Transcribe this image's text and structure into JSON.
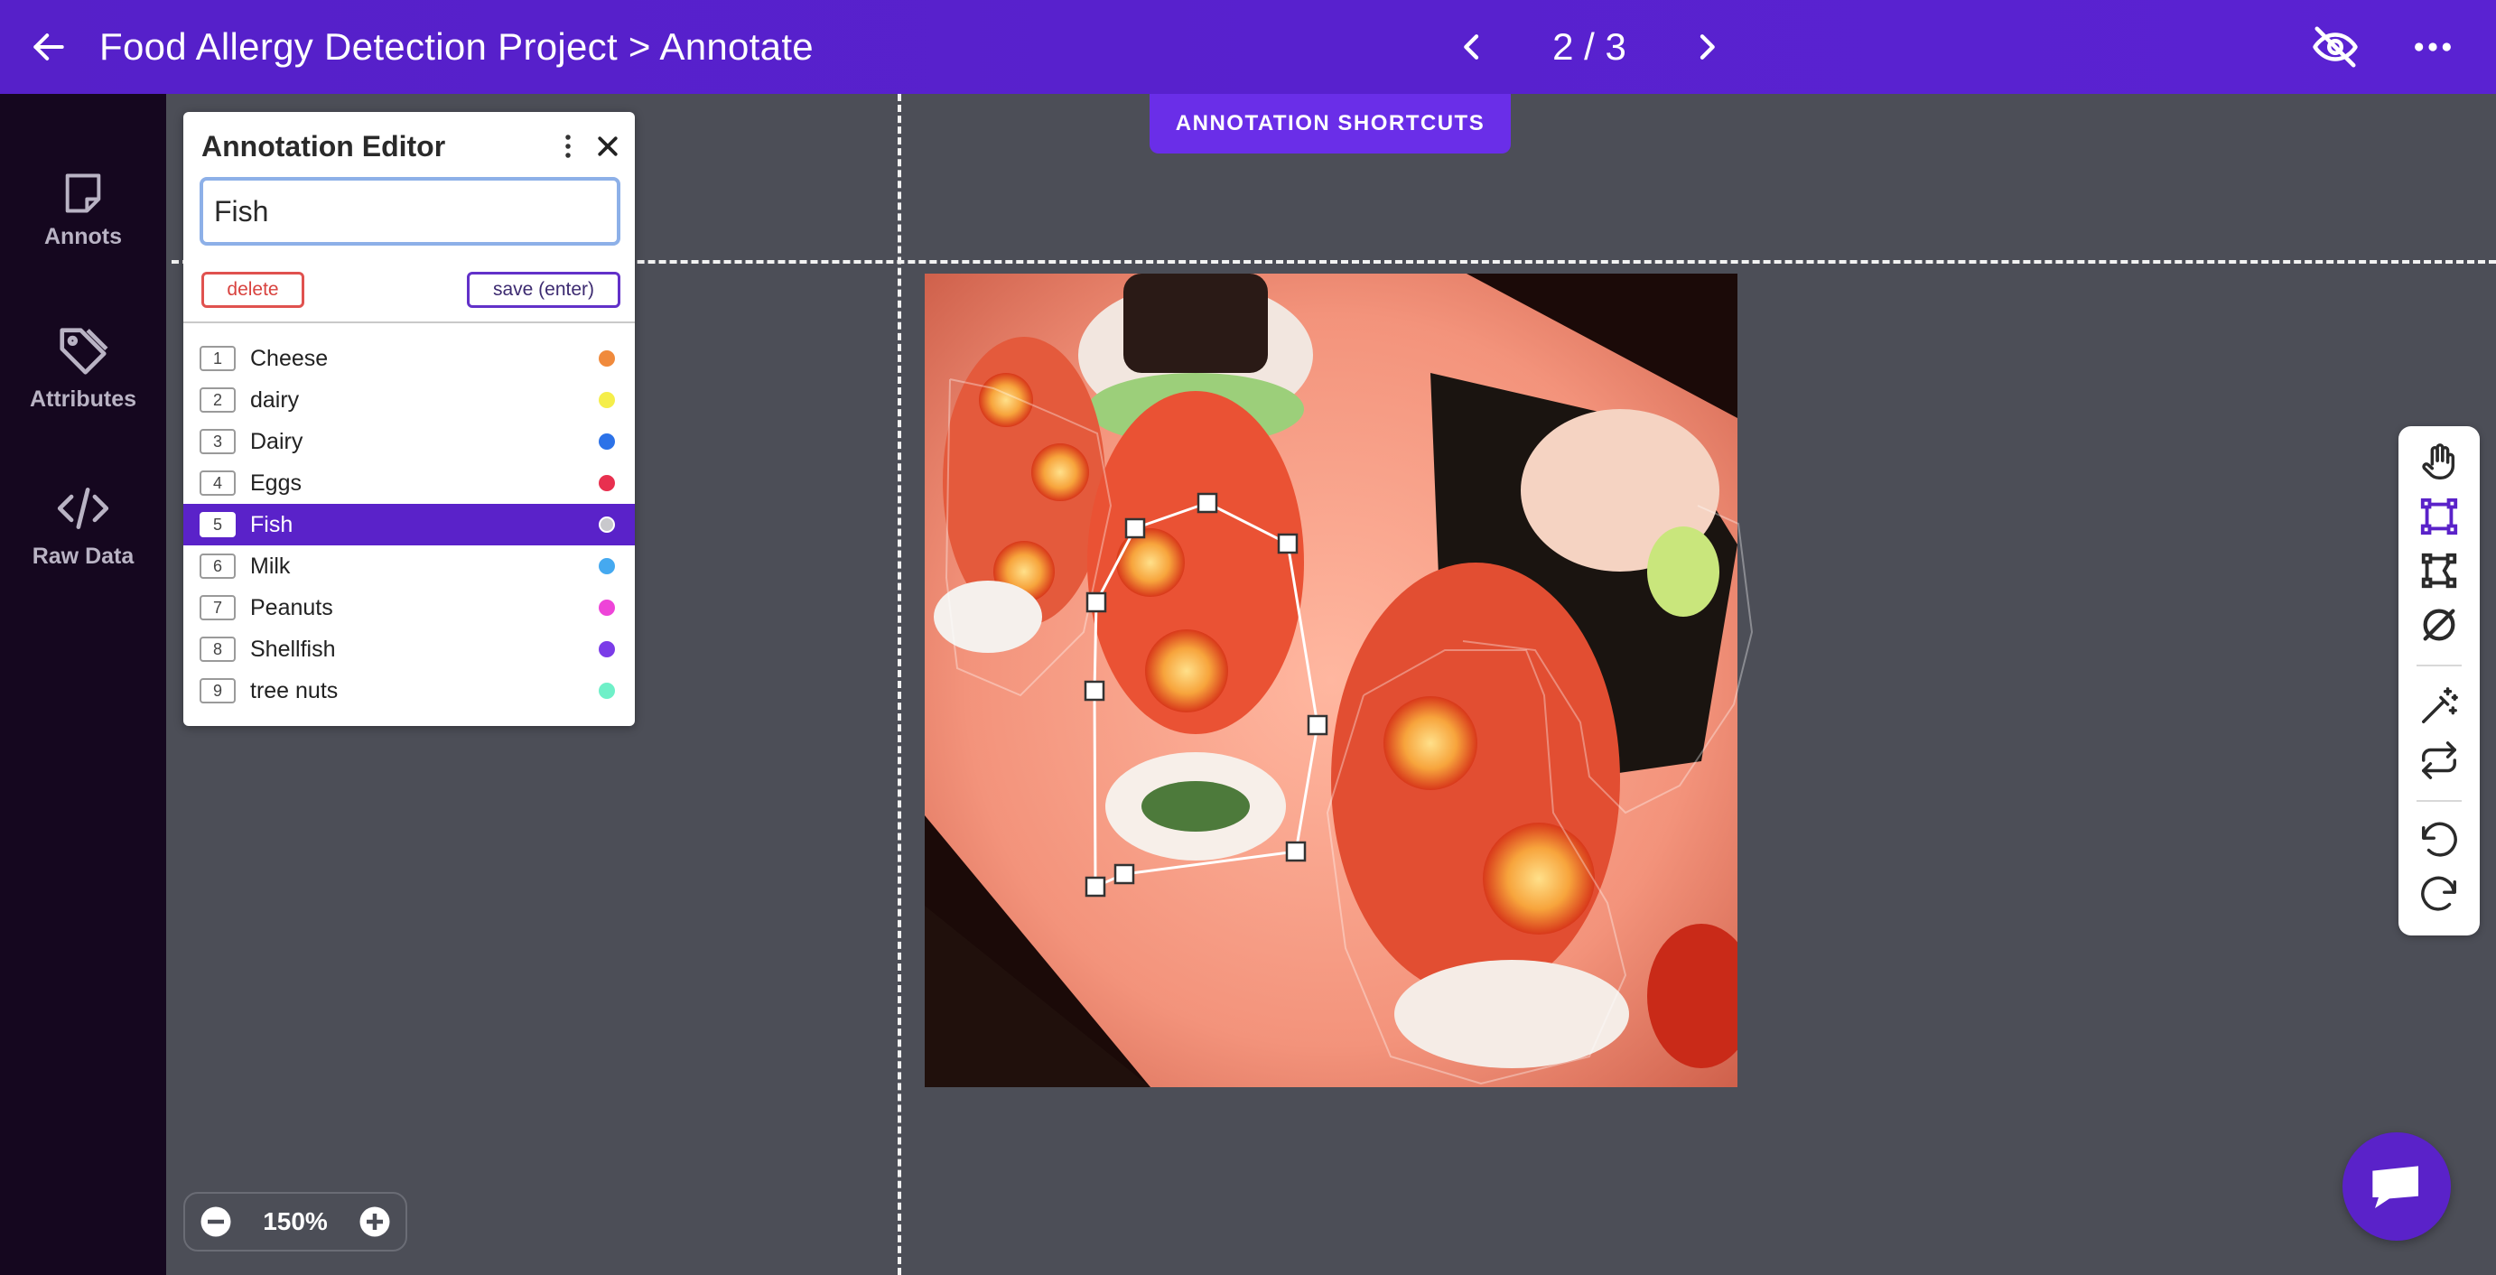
{
  "header": {
    "title": "Food Allergy Detection Project > Annotate",
    "page_indicator": "2 / 3",
    "colors": {
      "bar": "#5620c9"
    }
  },
  "sidebar": {
    "items": [
      {
        "label": "Annots",
        "icon": "sticky-note-icon"
      },
      {
        "label": "Attributes",
        "icon": "tag-icon"
      },
      {
        "label": "Raw Data",
        "icon": "code-icon"
      }
    ]
  },
  "shortcuts": {
    "label": "ANNOTATION SHORTCUTS"
  },
  "editor": {
    "title": "Annotation Editor",
    "input_value": "Fish",
    "delete_label": "delete",
    "save_label": "save (enter)",
    "classes": [
      {
        "num": "1",
        "name": "Cheese",
        "color": "#f08a3c"
      },
      {
        "num": "2",
        "name": "dairy",
        "color": "#f5ee4a"
      },
      {
        "num": "3",
        "name": "Dairy",
        "color": "#2c72e8"
      },
      {
        "num": "4",
        "name": "Eggs",
        "color": "#e8304f"
      },
      {
        "num": "5",
        "name": "Fish",
        "color": "#c8c8cc",
        "selected": true
      },
      {
        "num": "6",
        "name": "Milk",
        "color": "#45a9f0"
      },
      {
        "num": "7",
        "name": "Peanuts",
        "color": "#ee44d8"
      },
      {
        "num": "8",
        "name": "Shellfish",
        "color": "#7b3ce8"
      },
      {
        "num": "9",
        "name": "tree nuts",
        "color": "#6ff0c8"
      }
    ]
  },
  "tools": [
    "hand-icon",
    "bounding-box-icon",
    "polygon-icon",
    "null-icon",
    "magic-wand-icon",
    "repeat-icon",
    "undo-icon",
    "redo-icon"
  ],
  "zoom": {
    "value": "150%"
  },
  "accent": "#5a22c9"
}
